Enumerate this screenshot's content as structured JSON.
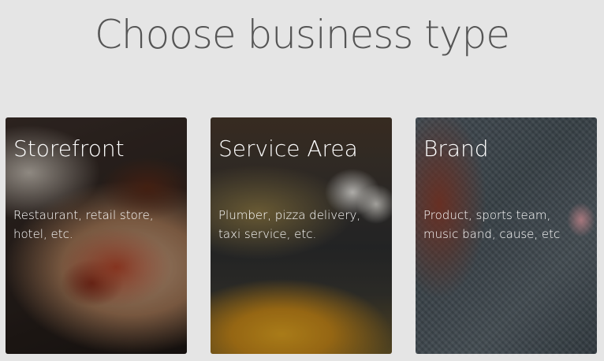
{
  "header": {
    "title": "Choose business type"
  },
  "cards": [
    {
      "title": "Storefront",
      "description_lines": [
        "Restaurant, retail store,",
        "hotel, etc."
      ]
    },
    {
      "title": "Service Area",
      "description_lines": [
        "Plumber, pizza delivery,",
        "taxi service, etc."
      ]
    },
    {
      "title": "Brand",
      "description_lines": [
        "Product, sports team,",
        "music band, cause, etc"
      ]
    }
  ]
}
